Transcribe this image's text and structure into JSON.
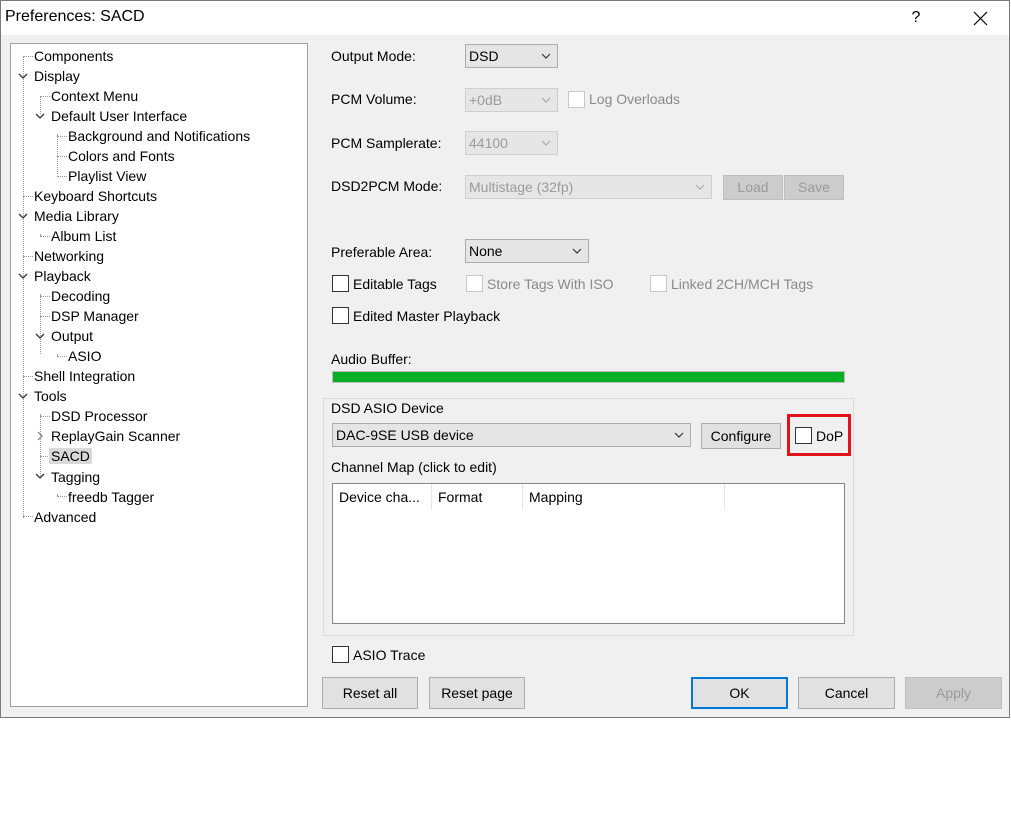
{
  "window": {
    "title": "Preferences: SACD",
    "help_label": "?"
  },
  "tree": [
    {
      "label": "Components"
    },
    {
      "label": "Display"
    },
    {
      "label": "Context Menu"
    },
    {
      "label": "Default User Interface"
    },
    {
      "label": "Background and Notifications"
    },
    {
      "label": "Colors and Fonts"
    },
    {
      "label": "Playlist View"
    },
    {
      "label": "Keyboard Shortcuts"
    },
    {
      "label": "Media Library"
    },
    {
      "label": "Album List"
    },
    {
      "label": "Networking"
    },
    {
      "label": "Playback"
    },
    {
      "label": "Decoding"
    },
    {
      "label": "DSP Manager"
    },
    {
      "label": "Output"
    },
    {
      "label": "ASIO"
    },
    {
      "label": "Shell Integration"
    },
    {
      "label": "Tools"
    },
    {
      "label": "DSD Processor"
    },
    {
      "label": "ReplayGain Scanner"
    },
    {
      "label": "SACD"
    },
    {
      "label": "Tagging"
    },
    {
      "label": "freedb Tagger"
    },
    {
      "label": "Advanced"
    }
  ],
  "settings": {
    "output_mode_label": "Output Mode:",
    "output_mode_value": "DSD",
    "pcm_volume_label": "PCM Volume:",
    "pcm_volume_value": "+0dB",
    "log_overloads_label": "Log Overloads",
    "pcm_samplerate_label": "PCM Samplerate:",
    "pcm_samplerate_value": "44100",
    "dsd2pcm_label": "DSD2PCM Mode:",
    "dsd2pcm_value": "Multistage (32fp)",
    "load_label": "Load",
    "save_label": "Save",
    "preferable_area_label": "Preferable Area:",
    "preferable_area_value": "None",
    "editable_tags_label": "Editable Tags",
    "store_tags_label": "Store Tags With ISO",
    "linked_tags_label": "Linked 2CH/MCH Tags",
    "edited_master_label": "Edited Master Playback",
    "audio_buffer_label": "Audio Buffer:",
    "audio_buffer_fill": 1.0
  },
  "asio": {
    "group_label": "DSD ASIO Device",
    "device_value": "DAC-9SE USB device",
    "configure_label": "Configure",
    "dop_label": "DoP",
    "channel_map_label": "Channel Map (click to edit)",
    "columns": [
      "Device cha...",
      "Format",
      "Mapping"
    ]
  },
  "asio_trace_label": "ASIO Trace",
  "buttons": {
    "reset_all": "Reset all",
    "reset_page": "Reset page",
    "ok": "OK",
    "cancel": "Cancel",
    "apply": "Apply"
  },
  "colors": {
    "highlight": "#e0121c",
    "progress": "#06b025",
    "accent": "#0078d7"
  }
}
